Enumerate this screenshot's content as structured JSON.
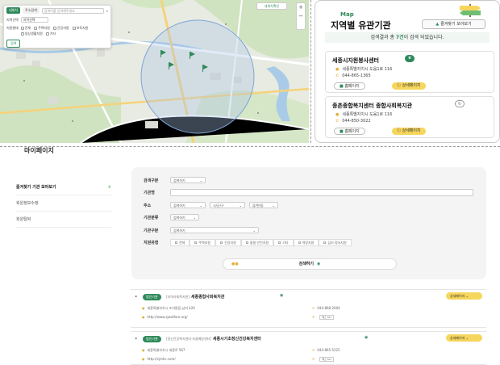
{
  "map": {
    "tabs": [
      "내위치",
      "주소검색"
    ],
    "search_placeholder": "검색어를 입력해주세요",
    "region_label": "지역선택",
    "region_value": "지역선택",
    "category_label": "지원형태",
    "categories": [
      "전체",
      "주택지원",
      "건강지원",
      "보육지원",
      "일상생활지원",
      "기타"
    ],
    "search_button": "검색",
    "location_button": "내위치확인",
    "zoom_in": "+",
    "zoom_out": "−"
  },
  "list_panel": {
    "badge": "Map",
    "title": "지역별 유관기관",
    "fav_button": "즐겨찾기 모아보기",
    "result_prefix": "검색결과 총 ",
    "result_count": "7건",
    "result_suffix": "이 검색 되었습니다.",
    "cards": [
      {
        "name": "세종시자원봉사센터",
        "address": "세종특별자치시 도움1로 116",
        "phone": "044-865-1365",
        "home": "홈페이지",
        "detail": "상세페이지"
      },
      {
        "name": "종촌종합복지센터 종합사회복지관",
        "address": "세종특별자치시 도움1로 116",
        "phone": "044-850-3022",
        "home": "홈페이지",
        "detail": "상세페이지"
      }
    ]
  },
  "mypage": {
    "title": "마이페이지",
    "menu": [
      {
        "label": "즐겨찾기 기관 모아보기",
        "active": true
      },
      {
        "label": "회원정보수정",
        "active": false
      },
      {
        "label": "회원탈퇴",
        "active": false
      }
    ]
  },
  "search_form": {
    "search_type_label": "검색구분",
    "search_type_value": "검색하기",
    "org_name_label": "기관명",
    "address_label": "주소",
    "address_selects": [
      "검색하기",
      "시/군/구",
      "읍/면/동"
    ],
    "org_type_label": "기관분류",
    "org_type_value": "검색하기",
    "org_class_label": "기관구분",
    "org_class_value": "검색하기",
    "support_label": "지원유형",
    "support_options": [
      "전체",
      "주택지원",
      "건강지원",
      "돌봄·안전지원",
      "기타",
      "역량지원",
      "심리·정서지원"
    ],
    "submit": "검색하기"
  },
  "results": [
    {
      "tag": "법인기관",
      "category": "[지역사회복지관]",
      "name": "세종종합사회복지관",
      "address": "세종특별자치시 조치원읍 남리 420",
      "url": "http://www.sjwelfare.org/",
      "phone": "044-868-2004",
      "fax": "팩스 Fax",
      "detail": "상세페이지"
    },
    {
      "tag": "법인기관",
      "category": "[정신건강복지센터·자살예방센터]",
      "name": "세종시기초정신건강복지센터",
      "address": "세종특별자치시 세종로 567",
      "url": "http://sjmhc.com/",
      "phone": "044-865-5225",
      "fax": "팩스 Fax",
      "detail": "상세페이지"
    }
  ]
}
